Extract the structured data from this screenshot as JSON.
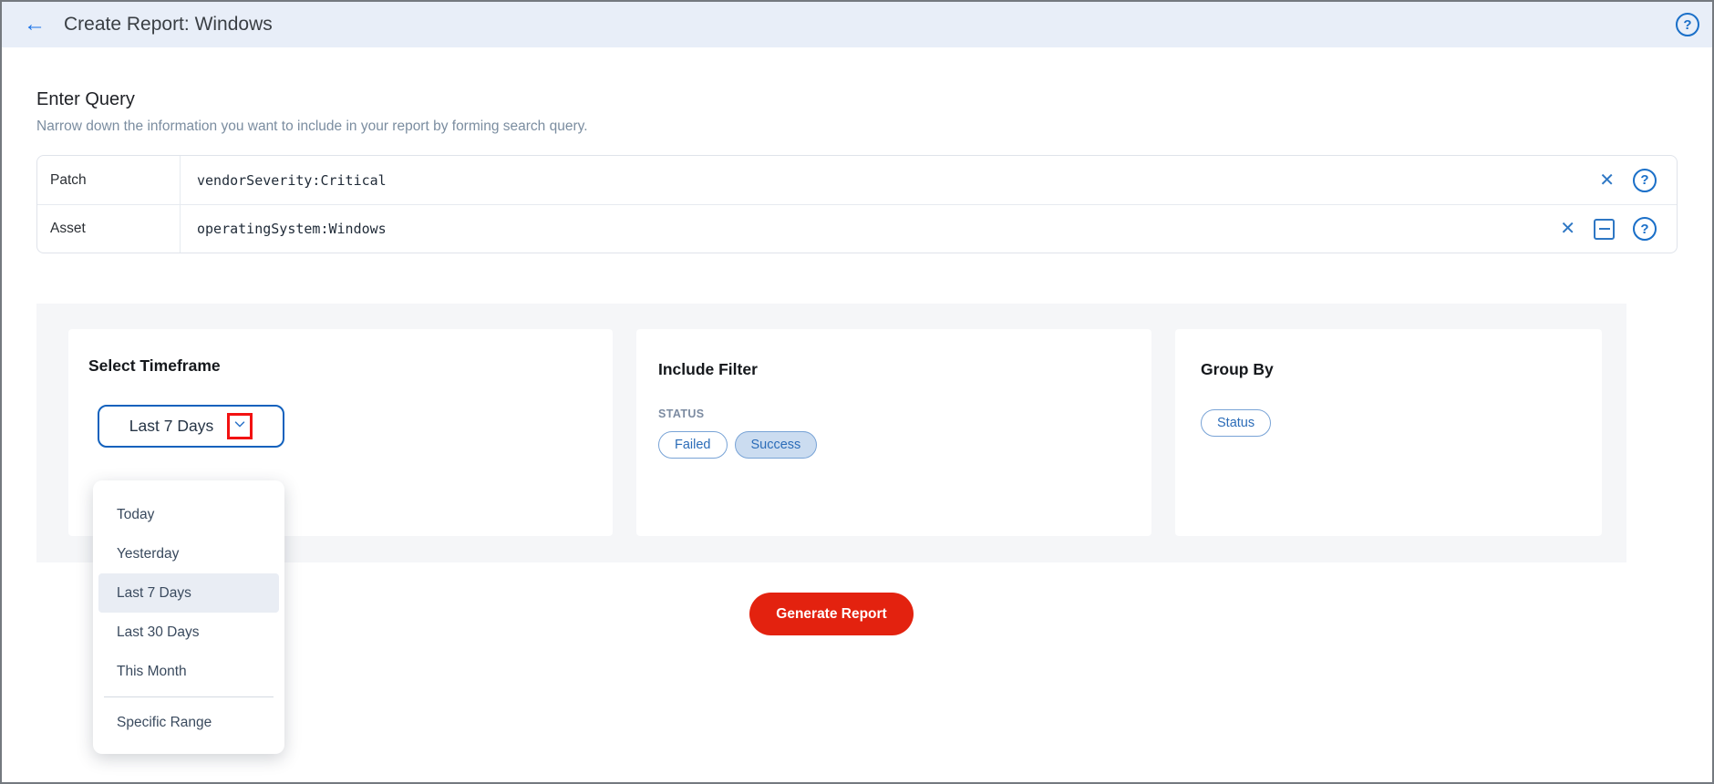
{
  "header": {
    "title": "Create Report: Windows",
    "back_glyph": "←",
    "help_glyph": "?"
  },
  "query_section": {
    "title": "Enter Query",
    "subtitle": "Narrow down the information you want to include in your report by forming search query.",
    "rows": [
      {
        "label": "Patch",
        "query": "vendorSeverity:Critical"
      },
      {
        "label": "Asset",
        "query": "operatingSystem:Windows"
      }
    ],
    "close_glyph": "✕",
    "help_glyph": "?"
  },
  "timeframe_card": {
    "title": "Select Timeframe",
    "selected_value": "Last 7 Days",
    "menu": {
      "items": [
        "Today",
        "Yesterday",
        "Last 7 Days",
        "Last 30 Days",
        "This Month"
      ],
      "selected_item": "Last 7 Days",
      "separated_item": "Specific Range"
    }
  },
  "include_filter_card": {
    "title": "Include Filter",
    "group_label": "STATUS",
    "chips": [
      {
        "label": "Failed",
        "selected": false
      },
      {
        "label": "Success",
        "selected": true
      }
    ]
  },
  "group_by_card": {
    "title": "Group By",
    "chips": [
      {
        "label": "Status"
      }
    ]
  },
  "actions": {
    "generate_label": "Generate Report"
  },
  "colors": {
    "accent_blue": "#1a6fc8",
    "header_bg": "#e8eef8",
    "section_bg": "#f5f6f8",
    "chip_selected_bg": "#cbdcf0",
    "generate_red": "#e3220f",
    "annotation_red": "#f21212"
  }
}
